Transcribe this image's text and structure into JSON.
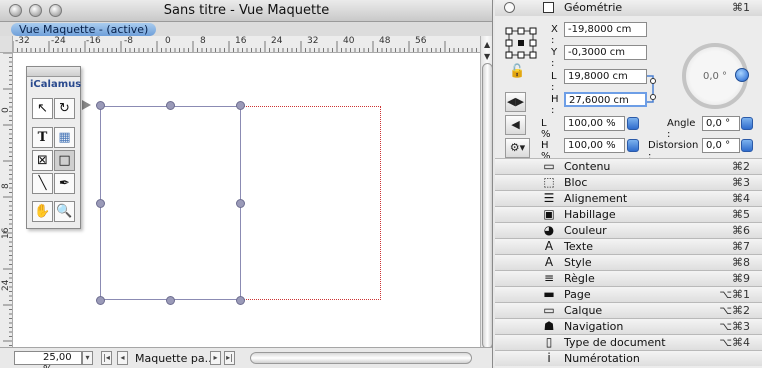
{
  "window": {
    "title": "Sans titre - Vue Maquette",
    "view_tab": "Vue Maquette - (active)",
    "zoom": "25,00 %",
    "page_name": "Maquette pa..."
  },
  "ruler": {
    "top": [
      "-32",
      "-24",
      "-16",
      "-8",
      "0",
      "8",
      "16",
      "24",
      "32",
      "40",
      "48",
      "56"
    ],
    "left": [
      "0",
      "8",
      "16",
      "24"
    ]
  },
  "tools": {
    "title": "iCalamus",
    "items": [
      {
        "icon": "arrow-icon",
        "glyph": "↖"
      },
      {
        "icon": "rotate-icon",
        "glyph": "↻"
      },
      {
        "icon": "text-icon",
        "glyph": "T"
      },
      {
        "icon": "image-icon",
        "glyph": "▦"
      },
      {
        "icon": "frame-cross-icon",
        "glyph": "⊠"
      },
      {
        "icon": "rectangle-icon",
        "glyph": "□"
      },
      {
        "icon": "line-icon",
        "glyph": "╲"
      },
      {
        "icon": "pen-icon",
        "glyph": "✒"
      },
      {
        "icon": "hand-icon",
        "glyph": "✋"
      },
      {
        "icon": "magnifier-icon",
        "glyph": "🔍"
      }
    ]
  },
  "inspector": {
    "geometry": {
      "title": "Géométrie",
      "shortcut": "⌘1",
      "x_label": "X :",
      "x_value": "-19,8000 cm",
      "y_label": "Y :",
      "y_value": "-0,3000 cm",
      "l_label": "L :",
      "l_value": "19,8000 cm",
      "h_label": "H :",
      "h_value": "27,6000 cm",
      "lpct_label": "L % :",
      "lpct_value": "100,00 %",
      "hpct_label": "H % :",
      "hpct_value": "100,00 %",
      "angle_label": "Angle :",
      "angle_value": "0,0 °",
      "distorsion_label": "Distorsion :",
      "distorsion_value": "0,0 °",
      "dial_value": "0,0 °"
    },
    "sections": [
      {
        "label": "Contenu",
        "shortcut": "⌘2",
        "icon": "content-icon"
      },
      {
        "label": "Bloc",
        "shortcut": "⌘3",
        "icon": "block-icon"
      },
      {
        "label": "Alignement",
        "shortcut": "⌘4",
        "icon": "alignment-icon"
      },
      {
        "label": "Habillage",
        "shortcut": "⌘5",
        "icon": "wrap-icon"
      },
      {
        "label": "Couleur",
        "shortcut": "⌘6",
        "icon": "color-icon"
      },
      {
        "label": "Texte",
        "shortcut": "⌘7",
        "icon": "text-icon"
      },
      {
        "label": "Style",
        "shortcut": "⌘8",
        "icon": "style-icon"
      },
      {
        "label": "Règle",
        "shortcut": "⌘9",
        "icon": "ruler-icon"
      },
      {
        "label": "Page",
        "shortcut": "⌥⌘1",
        "icon": "page-icon"
      },
      {
        "label": "Calque",
        "shortcut": "⌥⌘2",
        "icon": "layer-icon"
      },
      {
        "label": "Navigation",
        "shortcut": "⌥⌘3",
        "icon": "navigation-icon"
      },
      {
        "label": "Type de document",
        "shortcut": "⌥⌘4",
        "icon": "document-type-icon"
      },
      {
        "label": "Numérotation",
        "shortcut": "",
        "icon": "numbering-icon"
      }
    ]
  }
}
